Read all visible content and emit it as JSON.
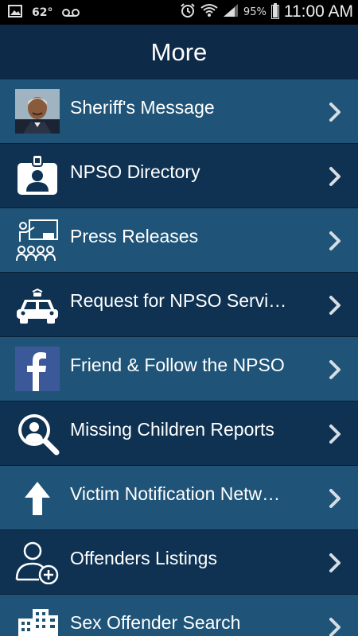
{
  "status_bar": {
    "temperature": "62°",
    "battery_percent": "95%",
    "battery_level": 0.95,
    "time": "11:00 AM",
    "icons": [
      "gallery-icon",
      "voicemail-icon",
      "alarm-icon",
      "wifi-icon",
      "signal-icon",
      "battery-icon"
    ]
  },
  "header": {
    "title": "More"
  },
  "colors": {
    "row_light": "#1f5478",
    "row_dark": "#0f3252",
    "header_bg": "#0d2a48",
    "facebook_blue": "#3b5998"
  },
  "menu": {
    "items": [
      {
        "label": "Sheriff's Message",
        "icon": "sheriff-photo"
      },
      {
        "label": "NPSO Directory",
        "icon": "id-badge-icon"
      },
      {
        "label": "Press Releases",
        "icon": "presentation-icon"
      },
      {
        "label": "Request for NPSO Servi…",
        "icon": "police-car-icon"
      },
      {
        "label": "Friend & Follow the NPSO",
        "icon": "facebook-icon"
      },
      {
        "label": "Missing Children Reports",
        "icon": "search-person-icon"
      },
      {
        "label": "Victim Notification Netw…",
        "icon": "arrow-up-icon"
      },
      {
        "label": "Offenders Listings",
        "icon": "add-person-icon"
      },
      {
        "label": "Sex Offender Search",
        "icon": "buildings-icon"
      }
    ]
  }
}
